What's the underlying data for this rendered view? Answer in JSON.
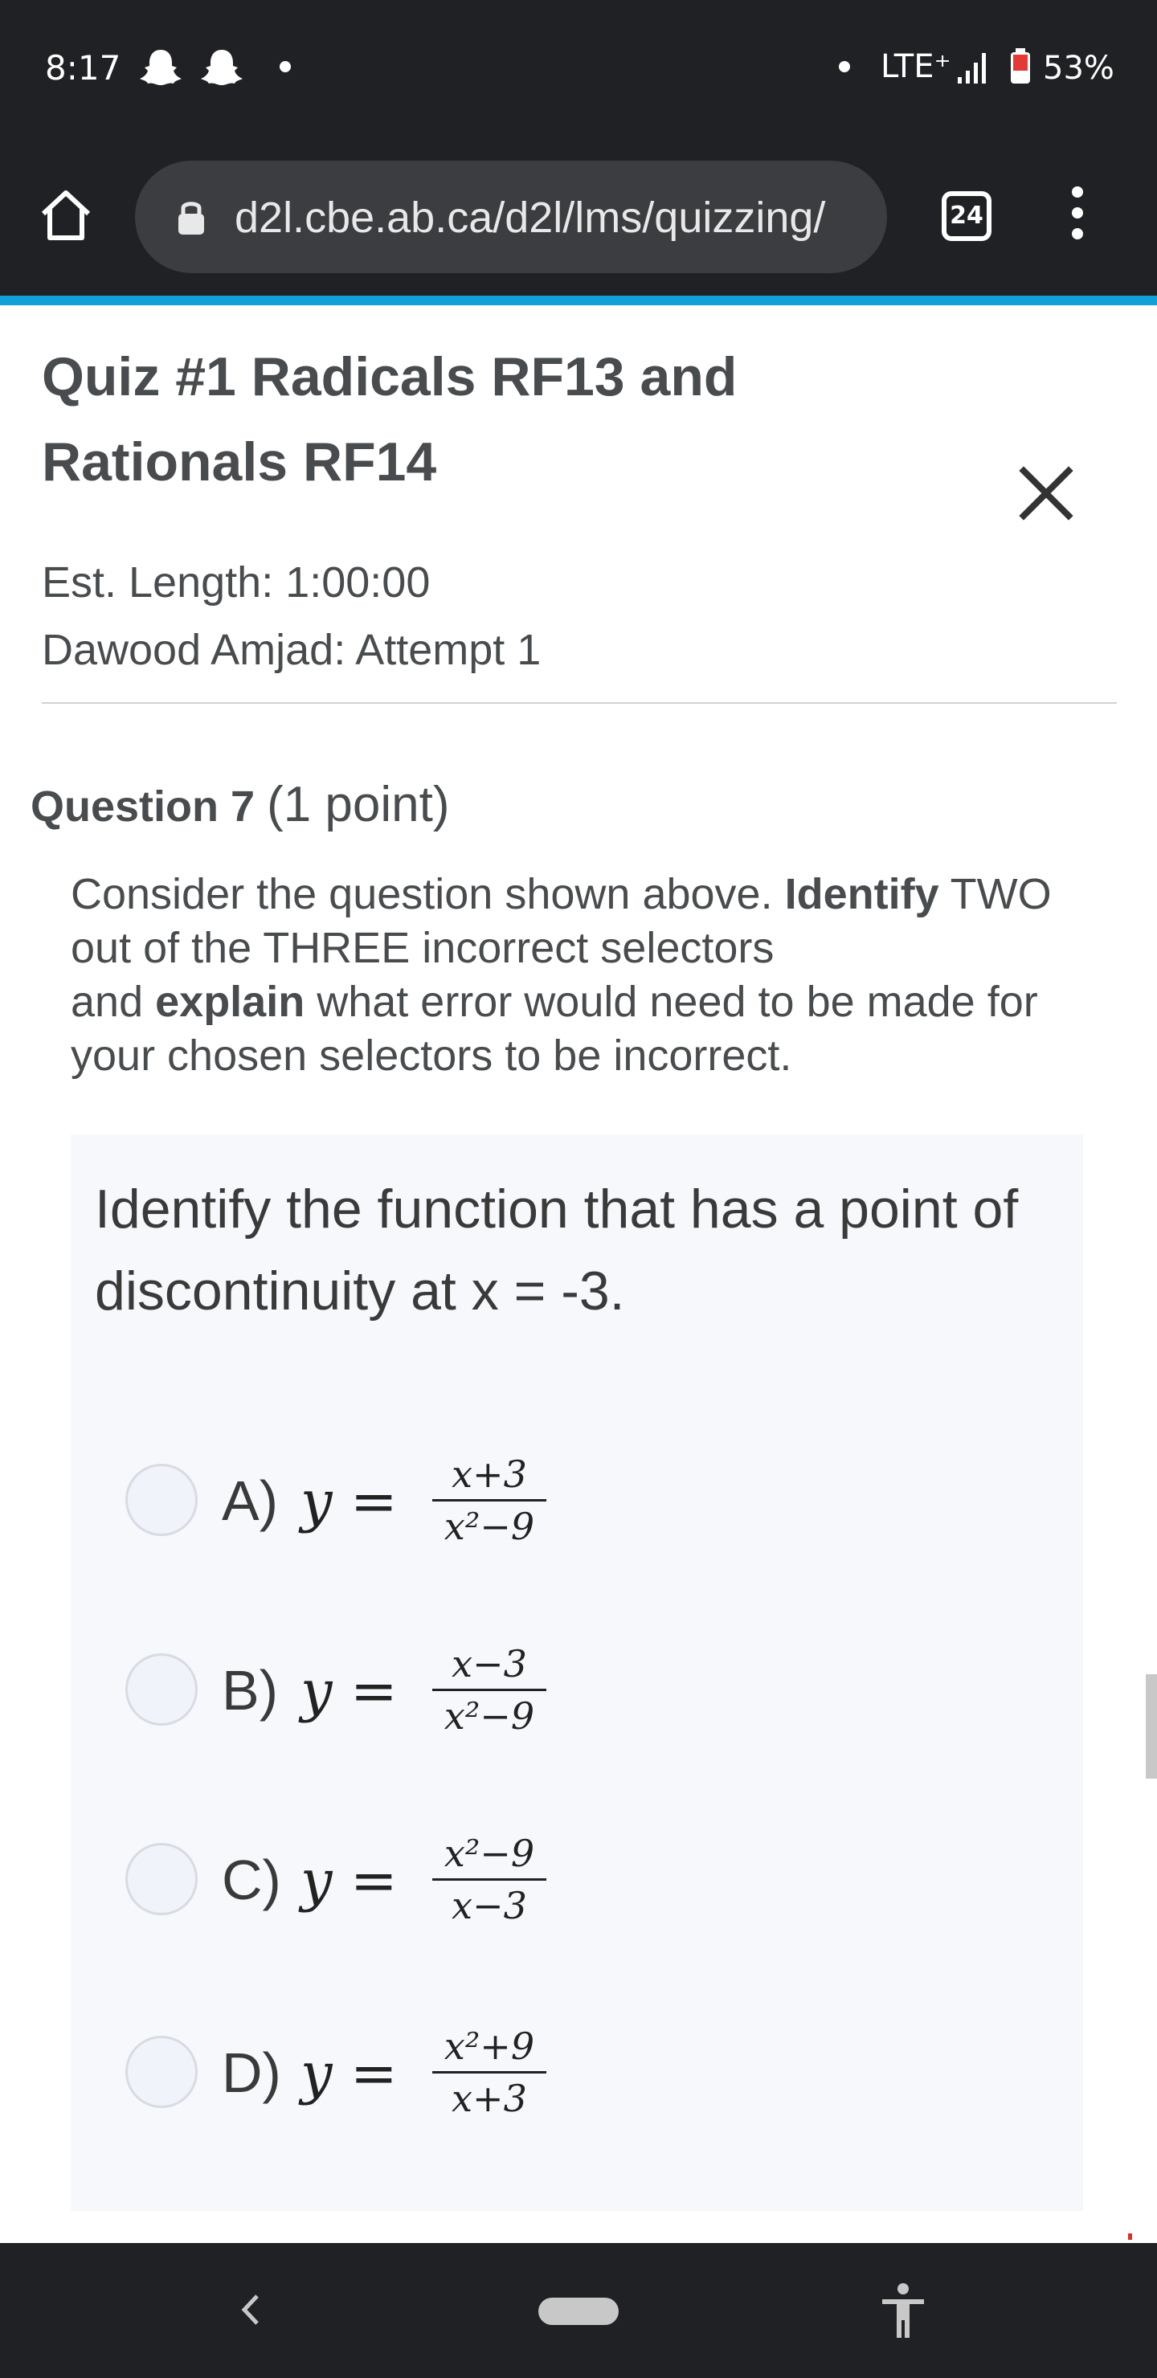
{
  "status_bar": {
    "time": "8:17",
    "network": "LTE⁺",
    "battery": "53%",
    "icons": [
      "snapchat-ghost-icon",
      "snapchat-ghost-icon",
      "notification-dot-icon",
      "signal-icon",
      "battery-icon"
    ]
  },
  "browser": {
    "url": "d2l.cbe.ab.ca/d2l/lms/quizzing/",
    "tab_count": "24",
    "accent_color": "#13a0d8"
  },
  "quiz": {
    "title": "Quiz #1 Radicals RF13 and Rationals RF14",
    "est_length": "Est. Length: 1:00:00",
    "attempt": "Dawood Amjad: Attempt 1"
  },
  "question": {
    "label": "Question 7",
    "points": "(1 point)",
    "prompt_part1": "Consider the question shown above.",
    "prompt_bold1": "Identify",
    "prompt_part2": "TWO out of the THREE incorrect selectors",
    "prompt_part3": "and",
    "prompt_bold2": "explain",
    "prompt_part4": "what error would need to be made for your chosen selectors to be incorrect."
  },
  "embedded_question": {
    "text": "Identify the function that has a point of discontinuity at x = -3.",
    "options": [
      {
        "letter": "A)",
        "y": "y",
        "eq": "=",
        "numerator": "x+3",
        "denominator": "x²−9"
      },
      {
        "letter": "B)",
        "y": "y",
        "eq": "=",
        "numerator": "x−3",
        "denominator": "x²−9"
      },
      {
        "letter": "C)",
        "y": "y",
        "eq": "=",
        "numerator": "x²−9",
        "denominator": "x−3"
      },
      {
        "letter": "D)",
        "y": "y",
        "eq": "=",
        "numerator": "x²+9",
        "denominator": "x+3"
      }
    ]
  }
}
